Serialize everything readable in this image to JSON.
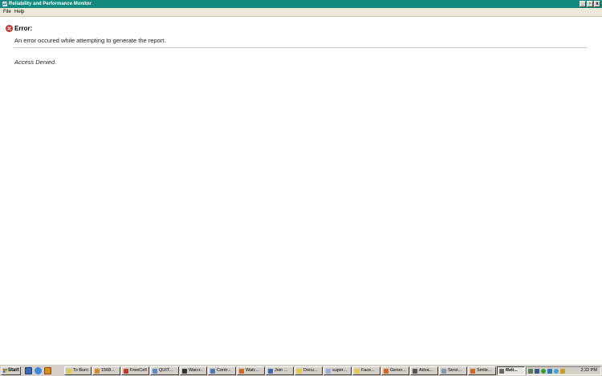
{
  "window": {
    "title": "Reliability and Performance Monitor",
    "controls": {
      "minimize": "_",
      "maximize": "▫",
      "close": "x"
    },
    "title_bar_color": "#0f8a7d"
  },
  "menu": {
    "items": [
      "File",
      "Help"
    ]
  },
  "report": {
    "error_heading": "Error:",
    "error_message": "An error occured while attempting to generate the report.",
    "error_detail": "Access Denied.",
    "error_icon": "error-x-icon"
  },
  "taskbar": {
    "start_label": "Start",
    "quick_launch": [
      "show-desktop-icon",
      "internet-explorer-icon",
      "media-player-icon"
    ],
    "tasks": [
      {
        "label": "To Burn",
        "icon": "folder-icon",
        "color": "#e5c84a"
      },
      {
        "label": "1568...",
        "icon": "app-icon",
        "color": "#d88a2c"
      },
      {
        "label": "FreeCell",
        "icon": "cards-icon",
        "color": "#c0392b"
      },
      {
        "label": "QUIT...",
        "icon": "window-icon",
        "color": "#5a8ac8"
      },
      {
        "label": "Warcr...",
        "icon": "game-icon",
        "color": "#333333"
      },
      {
        "label": "Contr...",
        "icon": "control-panel-icon",
        "color": "#4a7ab8"
      },
      {
        "label": "Watc...",
        "icon": "firefox-icon",
        "color": "#d8641e"
      },
      {
        "label": "Join ...",
        "icon": "window-icon",
        "color": "#3a6ab0"
      },
      {
        "label": "Docu...",
        "icon": "folder-icon",
        "color": "#e5c84a"
      },
      {
        "label": "super...",
        "icon": "document-icon",
        "color": "#8fb0d8"
      },
      {
        "label": "Face...",
        "icon": "folder-icon",
        "color": "#e5c84a"
      },
      {
        "label": "Gener...",
        "icon": "firefox-icon",
        "color": "#d8641e"
      },
      {
        "label": "Adva...",
        "icon": "settings-icon",
        "color": "#555555"
      },
      {
        "label": "Servi...",
        "icon": "services-icon",
        "color": "#7a9ab8"
      },
      {
        "label": "Smile...",
        "icon": "firefox-icon",
        "color": "#d8641e"
      },
      {
        "label": "Reli...",
        "icon": "monitor-icon",
        "color": "#6a6a6a",
        "active": true
      }
    ],
    "tray_icons": [
      "speaker-icon",
      "network-icon",
      "antivirus-icon",
      "update-icon",
      "messenger-icon",
      "shield-icon"
    ],
    "clock": "2:22 PM"
  }
}
